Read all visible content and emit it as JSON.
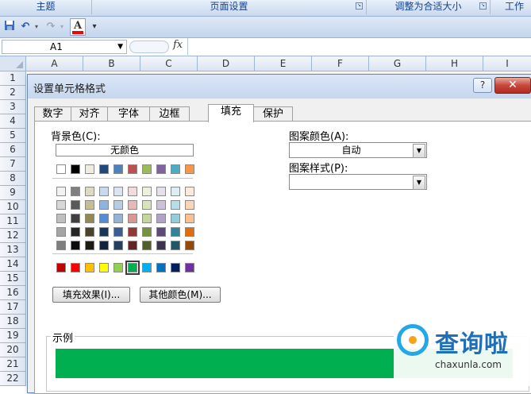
{
  "ribbon": {
    "groups": [
      {
        "label": "主题"
      },
      {
        "label": "页面设置"
      },
      {
        "label": "调整为合适大小"
      },
      {
        "label": "工作"
      }
    ]
  },
  "qat": {
    "buttons": [
      {
        "icon": "save-icon",
        "glyph": "💾"
      },
      {
        "icon": "undo-icon",
        "glyph": "↶"
      },
      {
        "icon": "redo-icon",
        "glyph": "↷"
      },
      {
        "icon": "font-color-icon",
        "glyph": "A"
      },
      {
        "icon": "customize-icon",
        "glyph": "▾"
      }
    ]
  },
  "formula_bar": {
    "name_box": "A1",
    "fx": "fx"
  },
  "grid": {
    "columns": [
      "A",
      "B",
      "C",
      "D",
      "E",
      "F",
      "G",
      "H",
      "I"
    ],
    "rows": [
      "1",
      "2",
      "3",
      "4",
      "5",
      "6",
      "7",
      "8",
      "9",
      "10",
      "11",
      "12",
      "13",
      "14",
      "15",
      "16",
      "17",
      "18",
      "19",
      "20",
      "21",
      "22"
    ]
  },
  "dialog": {
    "title": "设置单元格格式",
    "help": "?",
    "close": "✕",
    "tabs": [
      "数字",
      "对齐",
      "字体",
      "边框",
      "填充",
      "保护"
    ],
    "active_tab": 4,
    "bg_color_label": "背景色(C):",
    "no_color": "无颜色",
    "palette": {
      "top_row": [
        "#ffffff",
        "#000000",
        "#eeece1",
        "#1f497d",
        "#4f81bd",
        "#c0504d",
        "#9bbb59",
        "#8064a2",
        "#4bacc6",
        "#f79646"
      ],
      "tint_rows": [
        [
          "#f2f2f2",
          "#7f7f7f",
          "#ddd9c3",
          "#c6d9f0",
          "#dbe5f1",
          "#f2dcdb",
          "#ebf1dd",
          "#e5e0ec",
          "#dbeef3",
          "#fdeada"
        ],
        [
          "#d8d8d8",
          "#595959",
          "#c4bd97",
          "#8db3e2",
          "#b8cce4",
          "#e5b9b7",
          "#d7e3bc",
          "#ccc1d9",
          "#b7dde8",
          "#fbd5b5"
        ],
        [
          "#bfbfbf",
          "#3f3f3f",
          "#938953",
          "#548dd4",
          "#95b3d7",
          "#d99694",
          "#c3d69b",
          "#b2a2c7",
          "#92cddc",
          "#fac08f"
        ],
        [
          "#a5a5a5",
          "#262626",
          "#494429",
          "#17365d",
          "#366092",
          "#953734",
          "#76923c",
          "#5f497a",
          "#31859b",
          "#e36c09"
        ],
        [
          "#7f7f7f",
          "#0c0c0c",
          "#1d1b10",
          "#0f243e",
          "#244061",
          "#632423",
          "#4f6128",
          "#3f3151",
          "#205867",
          "#974806"
        ]
      ],
      "standard_row": [
        "#c00000",
        "#ff0000",
        "#ffc000",
        "#ffff00",
        "#92d050",
        "#00b050",
        "#00b0f0",
        "#0070c0",
        "#002060",
        "#7030a0"
      ],
      "selected_index": 5
    },
    "fill_effects_button": "填充效果(I)...",
    "more_colors_button": "其他颜色(M)...",
    "pattern_color_label": "图案颜色(A):",
    "pattern_color_value": "自动",
    "pattern_style_label": "图案样式(P):",
    "pattern_style_value": "",
    "sample_label": "示例",
    "sample_color": "#00b050"
  },
  "watermark": {
    "cn": "查询啦",
    "en": "chaxunla.com"
  }
}
